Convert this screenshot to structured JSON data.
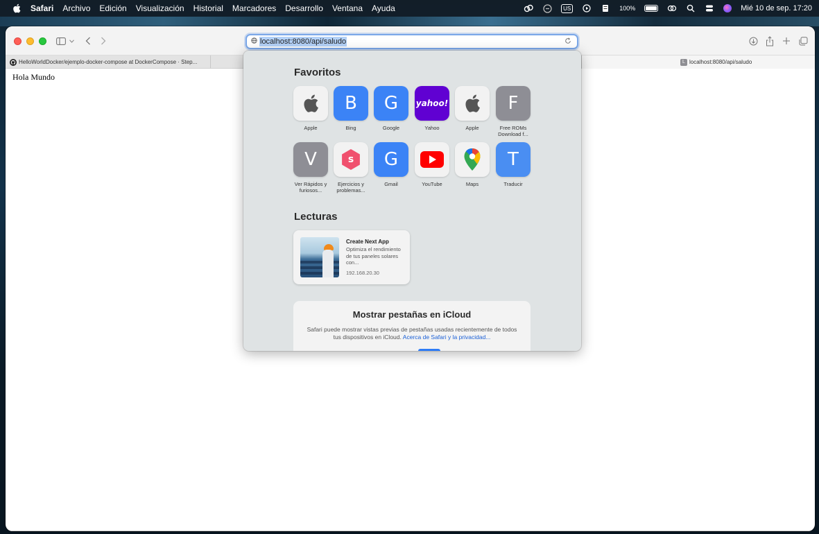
{
  "menubar": {
    "app_name": "Safari",
    "menus": [
      "Archivo",
      "Edición",
      "Visualización",
      "Historial",
      "Marcadores",
      "Desarrollo",
      "Ventana",
      "Ayuda"
    ],
    "keyboard_layout": "US",
    "battery_percent": "100%",
    "datetime": "Mié 10 de sep.  17:20"
  },
  "toolbar": {
    "url": "localhost:8080/api/saludo"
  },
  "tabs": [
    {
      "title": "HelloWorldDocker/ejemplo-docker-compose at DockerCompose · Step...",
      "favicon": "github-icon"
    },
    {
      "title": "localhost:8080/api/saludo",
      "favicon": "L"
    }
  ],
  "page": {
    "body_text": "Hola Mundo"
  },
  "start_page": {
    "favorites_title": "Favoritos",
    "favorites": [
      {
        "label": "Apple",
        "glyph": "",
        "icon": "apple-icon"
      },
      {
        "label": "Bing",
        "glyph": "B"
      },
      {
        "label": "Google",
        "glyph": "G"
      },
      {
        "label": "Yahoo",
        "glyph": "yahoo!"
      },
      {
        "label": "Apple",
        "glyph": "",
        "icon": "apple-icon"
      },
      {
        "label": "Free ROMs Download f...",
        "glyph": "F"
      },
      {
        "label": "Ver Rápidos y furiosos...",
        "glyph": "V"
      },
      {
        "label": "Ejercicios y problemas...",
        "glyph": "s"
      },
      {
        "label": "Gmail",
        "glyph": "G"
      },
      {
        "label": "YouTube",
        "glyph": "",
        "icon": "youtube-icon"
      },
      {
        "label": "Maps",
        "glyph": "",
        "icon": "maps-icon"
      },
      {
        "label": "Traducir",
        "glyph": "T"
      }
    ],
    "reading_title": "Lecturas",
    "reading_item": {
      "title": "Create Next App",
      "description": "Optimiza el rendimiento de tus paneles solares con...",
      "host": "192.168.20.30"
    },
    "icloud": {
      "title": "Mostrar pestañas en iCloud",
      "text": "Safari puede mostrar vistas previas de pestañas usadas recientemente de todos tus dispositivos en iCloud.",
      "link": "Acerca de Safari y la privacidad..."
    }
  },
  "colors": {
    "accent_blue": "#3b83f6",
    "yahoo_purple": "#6001d2",
    "panel_bg": "#dfe3e4"
  }
}
